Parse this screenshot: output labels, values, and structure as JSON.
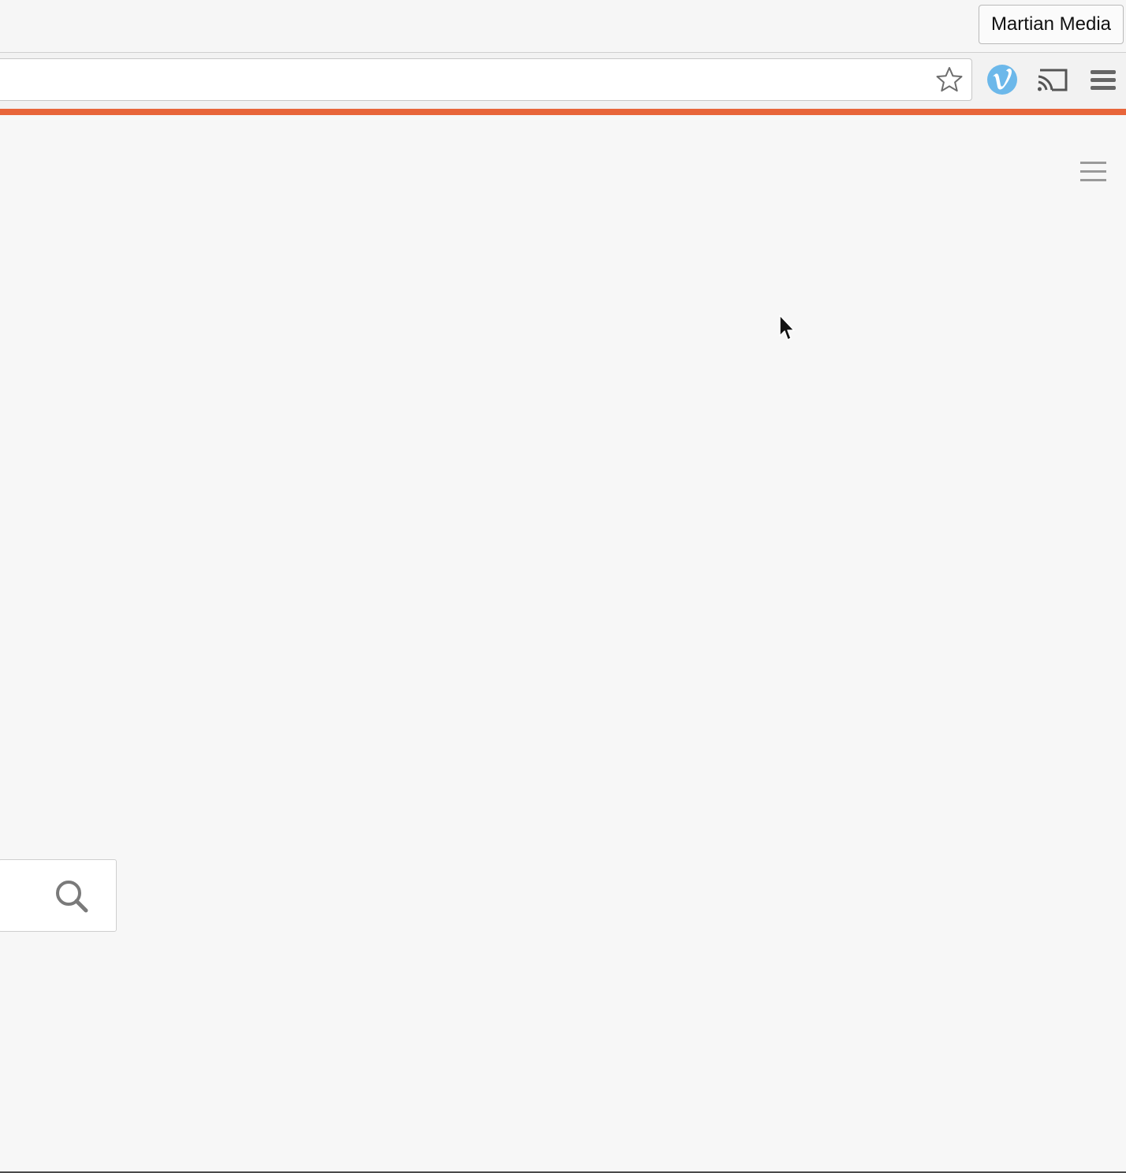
{
  "browser": {
    "profile_name": "Martian Media",
    "omnibox": {
      "value": "",
      "bookmark_icon": "star-icon"
    },
    "extensions": [
      {
        "name": "vimeo-icon",
        "color": "#6cb8ea"
      },
      {
        "name": "cast-icon"
      },
      {
        "name": "chrome-menu-icon"
      }
    ]
  },
  "theme": {
    "accent_color": "#e8653a",
    "background": "#f7f7f7"
  },
  "page": {
    "menu_icon": "hamburger-menu-icon",
    "search": {
      "value": "",
      "placeholder": "",
      "icon": "search-icon"
    }
  },
  "cursor": {
    "type": "arrow-pointer"
  }
}
